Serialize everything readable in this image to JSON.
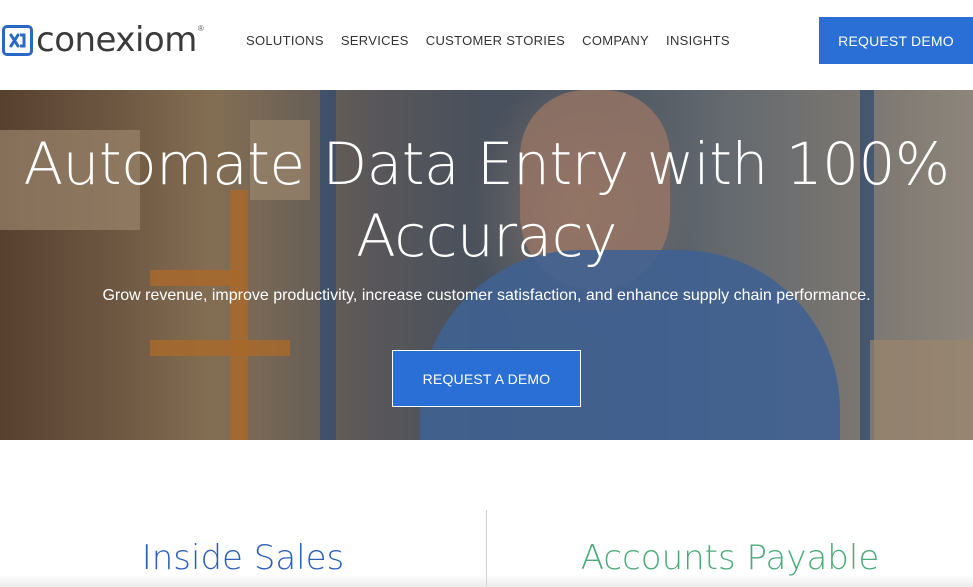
{
  "header": {
    "logo_text": "conexiom",
    "logo_reg": "®",
    "nav": [
      "SOLUTIONS",
      "SERVICES",
      "CUSTOMER STORIES",
      "COMPANY",
      "INSIGHTS"
    ],
    "cta_label": "REQUEST DEMO"
  },
  "hero": {
    "title": "Automate Data Entry with 100% Accuracy",
    "subtitle": "Grow revenue, improve productivity, increase customer satisfaction, and enhance supply chain performance.",
    "cta_label": "REQUEST A DEMO"
  },
  "sections": {
    "left_title": "Inside Sales",
    "right_title": "Accounts Payable"
  },
  "colors": {
    "brand_blue": "#2a6fd6",
    "left_title": "#2a5fb5",
    "right_title": "#4caa7a"
  },
  "icons": {
    "logo": "conexiom-logo-icon"
  }
}
